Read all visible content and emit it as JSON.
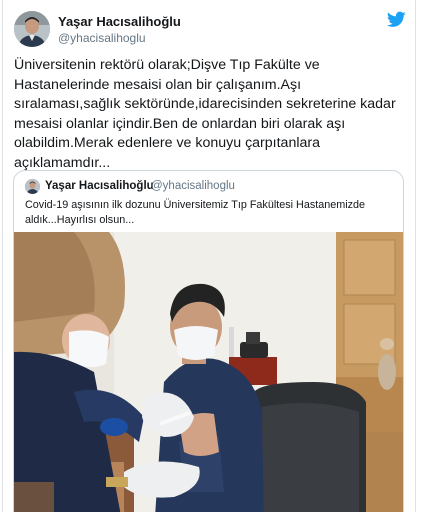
{
  "tweet": {
    "author_name": "Yaşar Hacısalihoğlu",
    "author_handle": "@yhacisalihoglu",
    "lines": [
      "Üniversitenin rektörü olarak;Dişve Tıp Fakülte ve",
      "Hastanelerinde mesaisi olan   bir çalışanım.Aşı",
      "sıralaması,sağlık sektöründe,idarecisinden sekreterine kadar",
      "mesaisi olanlar içindir.Ben de onlardan biri olarak aşı",
      "olabildim.Merak edenlere ve konuyu çarpıtanlara",
      "açıklamamdır..."
    ]
  },
  "quoted": {
    "author_name": "Yaşar Hacısalihoğlu",
    "author_handle": "@yhacisalihoglu",
    "lines": [
      "Covid-19 aşısının ilk dozunu Üniversitemiz Tıp Fakültesi Hastanemizde",
      "aldık...Hayırlısı olsun..."
    ]
  },
  "icons": {
    "platform": "twitter-bird-icon",
    "photo": "vaccination-photo"
  },
  "colors": {
    "brand": "#1da1f2",
    "text": "#14171a",
    "secondary": "#657786",
    "border": "#ccd6dd"
  }
}
